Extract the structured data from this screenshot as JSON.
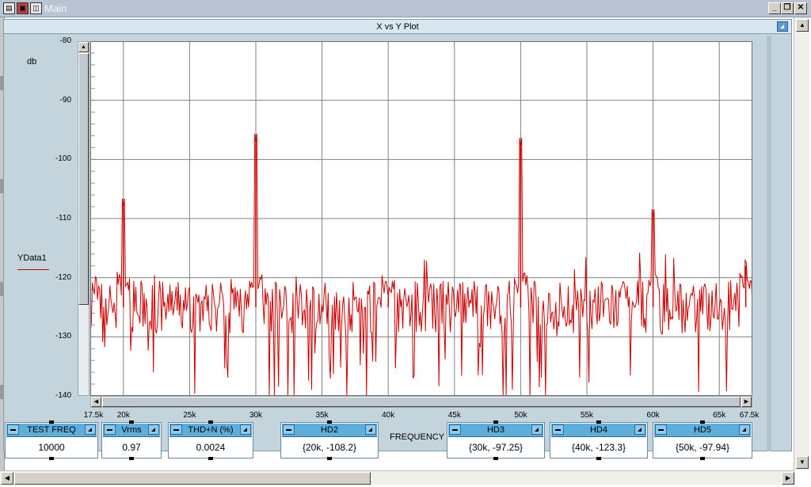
{
  "window": {
    "title": "Main"
  },
  "panel": {
    "title": "X vs Y Plot"
  },
  "chart_data": {
    "type": "line",
    "ylabel": "db",
    "xlabel": "FREQUENCY",
    "legend": [
      "YData1"
    ],
    "xlim": [
      17500,
      67500
    ],
    "ylim": [
      -140,
      -80
    ],
    "x_ticks": [
      "17.5k",
      "20k",
      "25k",
      "30k",
      "35k",
      "40k",
      "45k",
      "50k",
      "55k",
      "60k",
      "65k",
      "67.5k"
    ],
    "y_ticks": [
      "-80",
      "-90",
      "-100",
      "-110",
      "-120",
      "-130",
      "-140"
    ],
    "grid": true,
    "series": [
      {
        "name": "YData1",
        "color": "#cc0000",
        "noise_floor_db": -125,
        "peaks": [
          {
            "x": 17500,
            "y": -130
          },
          {
            "x": 20000,
            "y": -108.2
          },
          {
            "x": 30000,
            "y": -97.25
          },
          {
            "x": 40000,
            "y": -123.3
          },
          {
            "x": 50000,
            "y": -97.94
          },
          {
            "x": 60000,
            "y": -110
          },
          {
            "x": 67000,
            "y": -118
          }
        ]
      }
    ]
  },
  "widgets": [
    {
      "id": "test-freq",
      "label": "TEST FREQ",
      "value": "10000"
    },
    {
      "id": "vrms",
      "label": "Vrms",
      "value": "0.97"
    },
    {
      "id": "thdn",
      "label": "THD+N (%)",
      "value": "0.0024"
    },
    {
      "id": "hd2",
      "label": "HD2",
      "value": "{20k, -108.2}"
    },
    {
      "id": "hd3",
      "label": "HD3",
      "value": "{30k, -97.25}"
    },
    {
      "id": "hd4",
      "label": "HD4",
      "value": "{40k, -123.3}"
    },
    {
      "id": "hd5",
      "label": "HD5",
      "value": "{50k, -97.94}"
    }
  ]
}
